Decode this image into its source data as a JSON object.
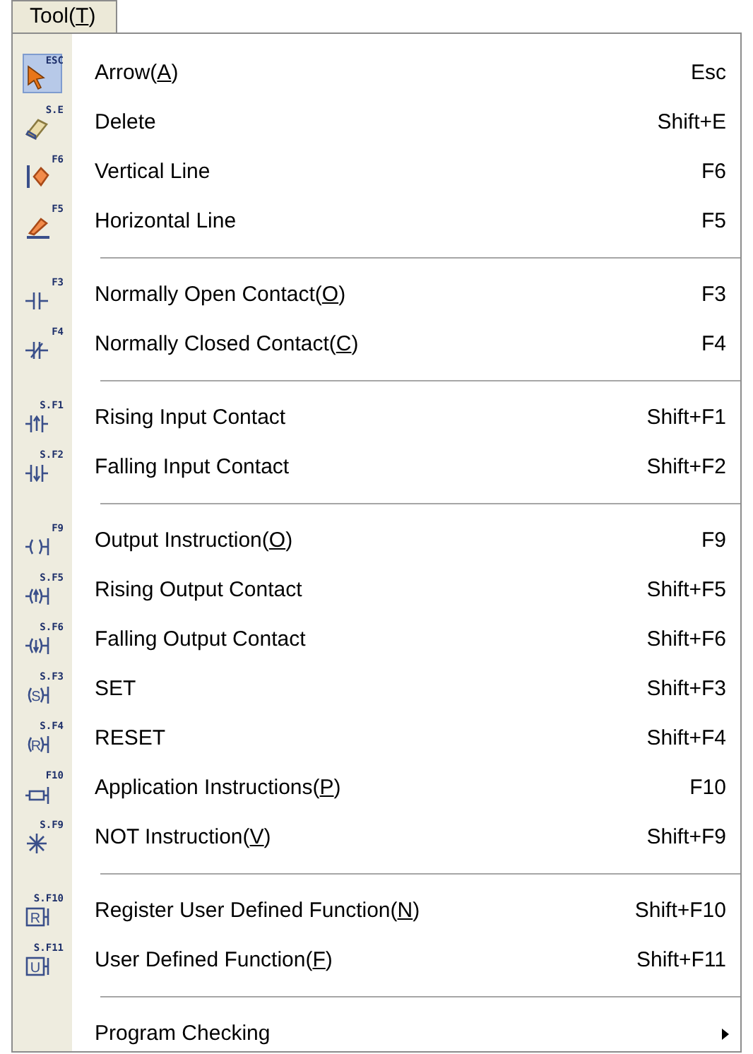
{
  "menu_title": {
    "before": "Tool(",
    "mnemonic": "T",
    "after": ")"
  },
  "groups": [
    [
      {
        "kind": "arrow",
        "icon_text": "ESC",
        "before": "Arrow(",
        "mnemonic": "A",
        "after": ")",
        "shortcut": "Esc",
        "selected": true
      },
      {
        "kind": "eraser",
        "icon_text": "S.E",
        "before": "Delete",
        "shortcut": "Shift+E",
        "selected": false
      },
      {
        "kind": "vline",
        "icon_text": "F6",
        "before": "Vertical Line",
        "shortcut": "F6",
        "selected": false
      },
      {
        "kind": "hline",
        "icon_text": "F5",
        "before": "Horizontal Line",
        "shortcut": "F5",
        "selected": false
      }
    ],
    [
      {
        "kind": "no_contact",
        "icon_text": "F3",
        "before": "Normally Open Contact(",
        "mnemonic": "O",
        "after": ")",
        "shortcut": "F3",
        "selected": false
      },
      {
        "kind": "nc_contact",
        "icon_text": "F4",
        "before": "Normally Closed Contact(",
        "mnemonic": "C",
        "after": ")",
        "shortcut": "F4",
        "selected": false
      }
    ],
    [
      {
        "kind": "rising_contact",
        "icon_text": "S.F1",
        "before": "Rising Input Contact",
        "shortcut": "Shift+F1",
        "selected": false
      },
      {
        "kind": "falling_contact",
        "icon_text": "S.F2",
        "before": "Falling Input Contact",
        "shortcut": "Shift+F2",
        "selected": false
      }
    ],
    [
      {
        "kind": "coil",
        "icon_text": "F9",
        "before": "Output Instruction(",
        "mnemonic": "O",
        "after": ")",
        "shortcut": "F9",
        "selected": false
      },
      {
        "kind": "rising_coil",
        "icon_text": "S.F5",
        "before": "Rising Output Contact",
        "shortcut": "Shift+F5",
        "selected": false
      },
      {
        "kind": "falling_coil",
        "icon_text": "S.F6",
        "before": "Falling Output Contact",
        "shortcut": "Shift+F6",
        "selected": false
      },
      {
        "kind": "letter_coil",
        "icon_text": "S.F3",
        "symbol": "S",
        "before": "SET",
        "shortcut": "Shift+F3",
        "selected": false
      },
      {
        "kind": "letter_coil",
        "icon_text": "S.F4",
        "symbol": "R",
        "before": "RESET",
        "shortcut": "Shift+F4",
        "selected": false
      },
      {
        "kind": "app_box",
        "icon_text": "F10",
        "before": "Application Instructions(",
        "mnemonic": "P",
        "after": ")",
        "shortcut": "F10",
        "selected": false
      },
      {
        "kind": "not",
        "icon_text": "S.F9",
        "before": "NOT Instruction(",
        "mnemonic": "V",
        "after": ")",
        "shortcut": "Shift+F9",
        "selected": false
      }
    ],
    [
      {
        "kind": "letter_box",
        "icon_text": "S.F10",
        "symbol": "R",
        "before": "Register User Defined Function(",
        "mnemonic": "N",
        "after": ")",
        "shortcut": "Shift+F10",
        "selected": false
      },
      {
        "kind": "letter_box",
        "icon_text": "S.F11",
        "symbol": "U",
        "before": "User Defined Function(",
        "mnemonic": "F",
        "after": ")",
        "shortcut": "Shift+F11",
        "selected": false
      }
    ],
    [
      {
        "kind": "plain",
        "before": "Program Checking",
        "submenu": true,
        "selected": false
      }
    ]
  ]
}
